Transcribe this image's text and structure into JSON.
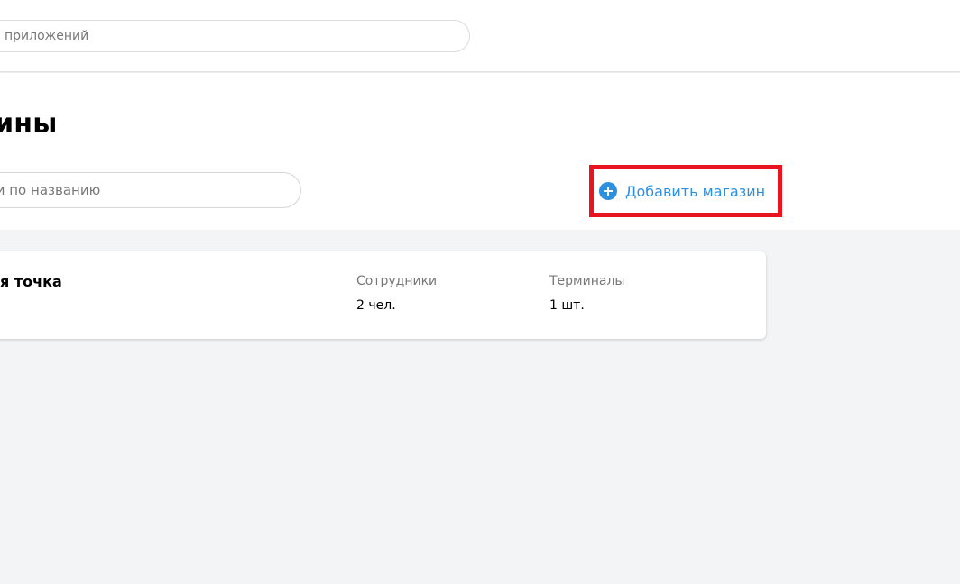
{
  "header": {
    "search_placeholder": "приложений"
  },
  "page": {
    "title": "азины",
    "search_placeholder": "ти по названию",
    "add_button_label": "Добавить магазин",
    "accent_color": "#2d8fe0",
    "highlight_color": "#e8141f"
  },
  "stores": [
    {
      "name": "я точка",
      "employees_label": "Сотрудники",
      "employees_value": "2 чел.",
      "terminals_label": "Терминалы",
      "terminals_value": "1 шт."
    }
  ],
  "icons": {
    "add": "plus-circle-icon"
  }
}
